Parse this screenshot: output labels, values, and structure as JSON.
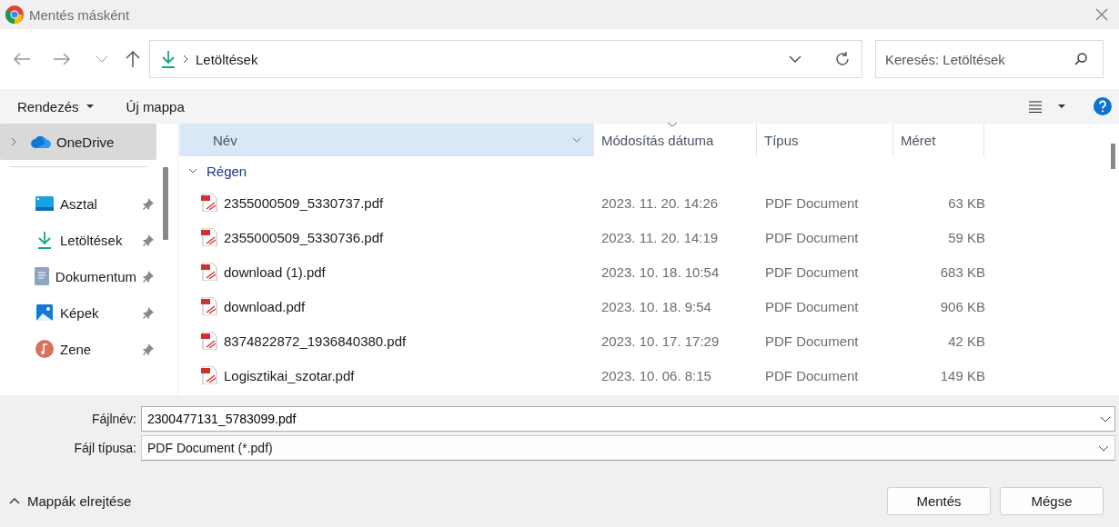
{
  "window": {
    "title": "Mentés másként"
  },
  "nav": {
    "path": "Letöltések",
    "search": {
      "placeholder": "Keresés: Letöltések"
    }
  },
  "toolbar": {
    "organize": "Rendezés",
    "new_folder": "Új mappa"
  },
  "sidebar": {
    "items": [
      {
        "label": "OneDrive",
        "kind": "cloud",
        "selected": true,
        "pinned": false
      },
      {
        "label": "Asztal",
        "kind": "desktop",
        "selected": false,
        "pinned": true
      },
      {
        "label": "Letöltések",
        "kind": "downloads",
        "selected": false,
        "pinned": true
      },
      {
        "label": "Dokumentum",
        "kind": "documents",
        "selected": false,
        "pinned": true
      },
      {
        "label": "Képek",
        "kind": "pictures",
        "selected": false,
        "pinned": true
      },
      {
        "label": "Zene",
        "kind": "music",
        "selected": false,
        "pinned": true
      }
    ]
  },
  "file_list": {
    "columns": [
      {
        "label": "Név",
        "selected": true
      },
      {
        "label": "Módosítás dátuma",
        "selected": false
      },
      {
        "label": "Típus",
        "selected": false
      },
      {
        "label": "Méret",
        "selected": false
      }
    ],
    "group": {
      "label": "Régen",
      "expanded": true
    },
    "rows": [
      {
        "name": "2355000509_5330737.pdf",
        "date": "2023. 11. 20. 14:26",
        "type": "PDF Document",
        "size": "63 KB"
      },
      {
        "name": "2355000509_5330736.pdf",
        "date": "2023. 11. 20. 14:19",
        "type": "PDF Document",
        "size": "59 KB"
      },
      {
        "name": "download (1).pdf",
        "date": "2023. 10. 18. 10:54",
        "type": "PDF Document",
        "size": "683 KB"
      },
      {
        "name": "download.pdf",
        "date": "2023. 10. 18. 9:54",
        "type": "PDF Document",
        "size": "906 KB"
      },
      {
        "name": "8374822872_1936840380.pdf",
        "date": "2023. 10. 17. 17:29",
        "type": "PDF Document",
        "size": "42 KB"
      },
      {
        "name": "Logisztikai_szotar.pdf",
        "date": "2023. 10. 06. 8:15",
        "type": "PDF Document",
        "size": "149 KB"
      }
    ]
  },
  "save_fields": {
    "filename": {
      "label": "Fájlnév:",
      "value": "2300477131_5783099.pdf"
    },
    "filetype": {
      "label": "Fájl típusa:",
      "value": "PDF Document (*.pdf)"
    }
  },
  "footer": {
    "toggle": "Mappák elrejtése",
    "buttons": [
      "Mentés",
      "Mégse"
    ]
  }
}
